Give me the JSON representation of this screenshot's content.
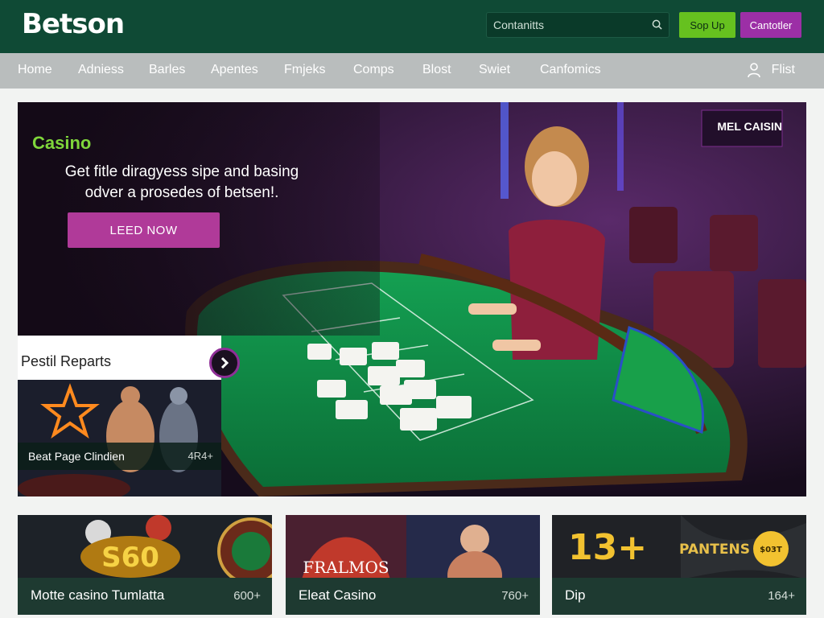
{
  "header": {
    "logo": "Betson",
    "search_placeholder": "Contanitts",
    "signup_label": "Sop Up",
    "contact_label": "Cantotler"
  },
  "nav": {
    "items": [
      "Home",
      "Adniess",
      "Barles",
      "Apentes",
      "Fmjeks",
      "Comps",
      "Blost",
      "Swiet",
      "Canfomics"
    ],
    "user_label": "Flist"
  },
  "hero": {
    "title": "Casino",
    "text": "Get fitle diragyess sipe and basing odver a prosedes of betsen!.",
    "cta_label": "LEED NOW",
    "sign": "MEL CAISIN"
  },
  "reports": {
    "title": "Pestil Reparts",
    "item_title": "Beat Page Clindien",
    "item_count": "4R4+"
  },
  "cards": [
    {
      "title": "Motte casino Tumlatta",
      "count": "600+",
      "art": "S60"
    },
    {
      "title": "Eleat Casino",
      "count": "760+",
      "art": "FRALMOS"
    },
    {
      "title": "Dip",
      "count": "164+",
      "art": "13+",
      "art2": "PANTENS",
      "badge": "$03T"
    }
  ],
  "colors": {
    "header_bg": "#0f4a35",
    "signup": "#66c11f",
    "contact": "#9c2fa6",
    "cta": "#b03a99",
    "table": "#0f8a47"
  }
}
